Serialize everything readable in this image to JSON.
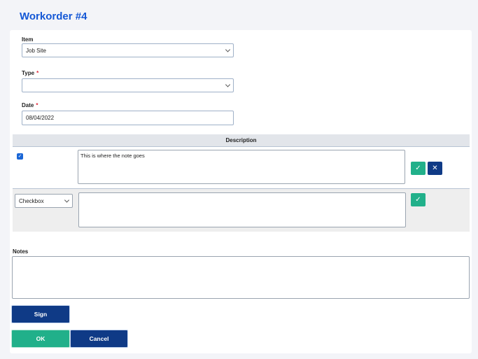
{
  "page": {
    "title": "Workorder #4"
  },
  "form": {
    "item": {
      "label": "Item",
      "value": "Job Site"
    },
    "type": {
      "label": "Type",
      "required_mark": "*",
      "value": ""
    },
    "date": {
      "label": "Date",
      "required_mark": "*",
      "value": "08/04/2022"
    }
  },
  "description_table": {
    "header": "Description",
    "rows": [
      {
        "checked": true,
        "checkbox_glyph": "✓",
        "note": "This is where the note goes",
        "confirm_icon": "✓",
        "delete_icon": "✕"
      },
      {
        "kind_select": "Checkbox",
        "note": "",
        "confirm_icon": "✓"
      }
    ]
  },
  "notes": {
    "label": "Notes",
    "value": ""
  },
  "buttons": {
    "sign": "Sign",
    "ok": "OK",
    "cancel": "Cancel"
  },
  "colors": {
    "title": "#1558d6",
    "accent_green": "#21b08a",
    "navy": "#0f3a86",
    "required": "#e0283a"
  },
  "icons": [
    "chevron-down-icon",
    "checkmark-icon",
    "close-icon"
  ]
}
